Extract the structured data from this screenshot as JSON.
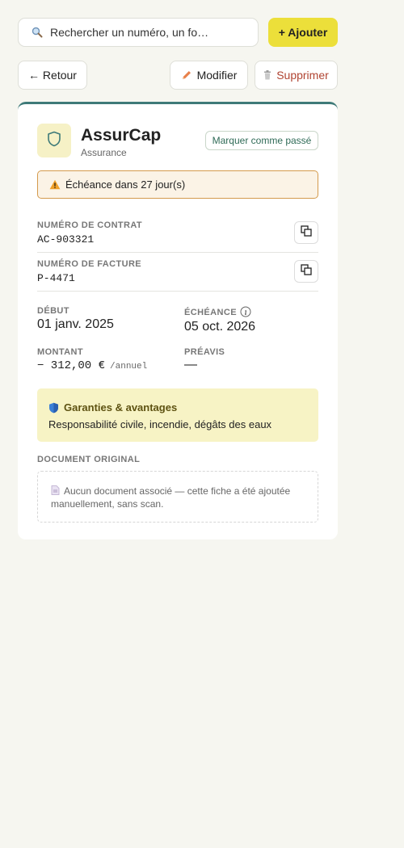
{
  "search": {
    "placeholder": "Rechercher un numéro, un fo…",
    "icon": "search-icon"
  },
  "toolbar": {
    "add_label": "+ Ajouter",
    "back_label": "← Retour",
    "edit_label": "Modifier",
    "delete_label": "Supprimer"
  },
  "card": {
    "accent_color": "#3e7a78",
    "provider": "AssurCap",
    "category": "Assurance",
    "mark_label": "Marquer comme passé",
    "alert_text": "Échéance dans 27 jour(s)",
    "contract": {
      "label": "NUMÉRO DE CONTRAT",
      "value": "AC-903321"
    },
    "invoice": {
      "label": "NUMÉRO DE FACTURE",
      "value": "P-4471"
    },
    "start": {
      "label": "DÉBUT",
      "value": "01 janv. 2025"
    },
    "due": {
      "label": "ÉCHÉANCE",
      "value": "05 oct. 2026"
    },
    "amount": {
      "label": "MONTANT",
      "value": "− 312,00 €",
      "unit": "/annuel"
    },
    "notice": {
      "label": "PRÉAVIS",
      "value": "—"
    },
    "guarantees": {
      "title": "Garanties & avantages",
      "text": "Responsabilité civile, incendie, dégâts des eaux"
    },
    "document": {
      "label": "DOCUMENT ORIGINAL",
      "empty_text": "Aucun document associé — cette fiche a été ajoutée manuellement, sans scan."
    }
  }
}
